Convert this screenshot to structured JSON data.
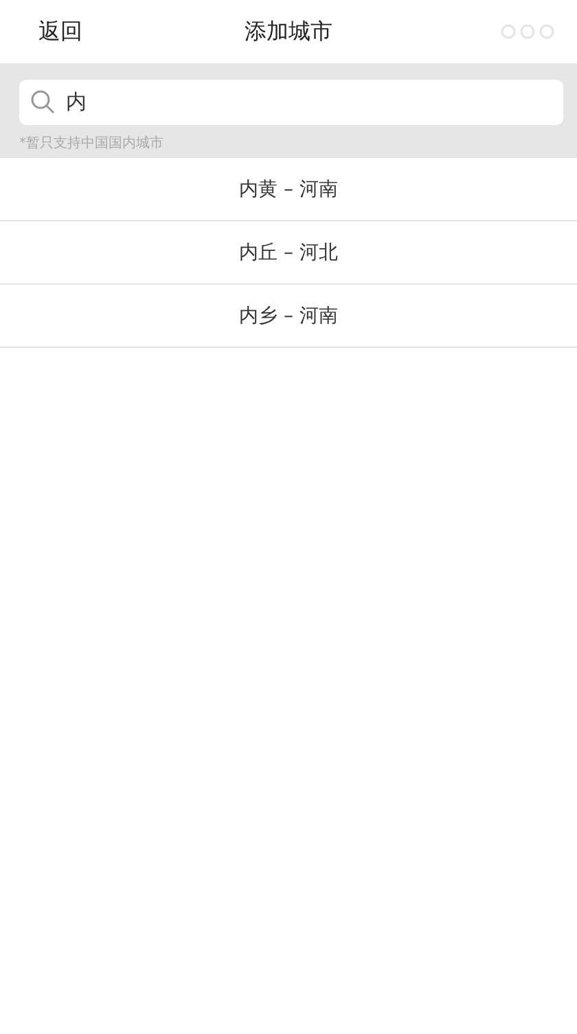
{
  "header": {
    "back": "返回",
    "title": "添加城市"
  },
  "search": {
    "value": "内",
    "hint": "*暂只支持中国国内城市"
  },
  "results": [
    {
      "label": "内黄 – 河南"
    },
    {
      "label": "内丘 – 河北"
    },
    {
      "label": "内乡 – 河南"
    }
  ]
}
